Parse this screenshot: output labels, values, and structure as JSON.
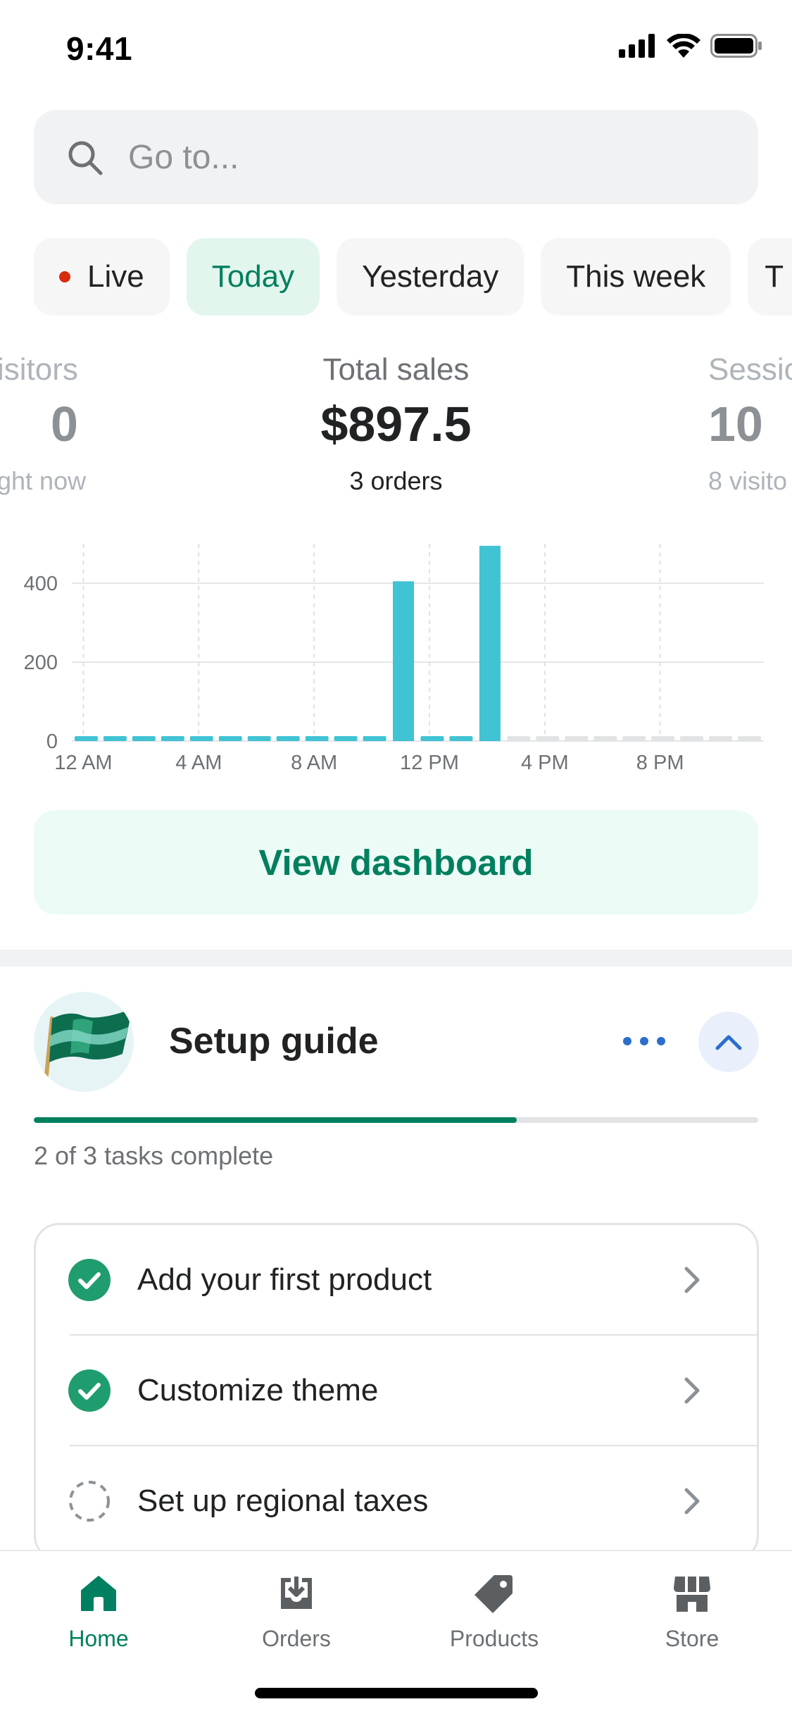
{
  "status_bar": {
    "time": "9:41"
  },
  "search": {
    "placeholder": "Go to..."
  },
  "filters": [
    {
      "label": "Live"
    },
    {
      "label": "Today",
      "active": true
    },
    {
      "label": "Yesterday"
    },
    {
      "label": "This week"
    },
    {
      "label": "T"
    }
  ],
  "metrics": {
    "left": {
      "label": "isitors",
      "value": "0",
      "sub": "ght now"
    },
    "center": {
      "label": "Total sales",
      "value": "$897.5",
      "sub": "3 orders"
    },
    "right": {
      "label": "Sessio",
      "value": "10",
      "sub": "8 visito"
    }
  },
  "chart_data": {
    "type": "bar",
    "x_tick_labels": [
      "12 AM",
      "4 AM",
      "8 AM",
      "12 PM",
      "4 PM",
      "8 PM"
    ],
    "y_tick_labels": [
      "0",
      "200",
      "400"
    ],
    "ylim": [
      0,
      500
    ],
    "hours": [
      "12 AM",
      "1 AM",
      "2 AM",
      "3 AM",
      "4 AM",
      "5 AM",
      "6 AM",
      "7 AM",
      "8 AM",
      "9 AM",
      "10 AM",
      "11 AM",
      "12 PM",
      "1 PM",
      "2 PM",
      "3 PM",
      "4 PM",
      "5 PM",
      "6 PM",
      "7 PM",
      "8 PM",
      "9 PM",
      "10 PM",
      "11 PM"
    ],
    "values": [
      0,
      0,
      0,
      0,
      0,
      0,
      0,
      0,
      0,
      0,
      0,
      405,
      0,
      0,
      495,
      0,
      0,
      0,
      0,
      0,
      0,
      0,
      0,
      0
    ],
    "future_from_hour": 15,
    "colors": {
      "bar": "#40c3d3",
      "future": "#e1e3e5"
    }
  },
  "dashboard_button": {
    "label": "View dashboard"
  },
  "setup_guide": {
    "title": "Setup guide",
    "progress_fraction": 0.667,
    "progress_text": "2 of 3 tasks complete",
    "tasks": [
      {
        "label": "Add your first product",
        "complete": true
      },
      {
        "label": "Customize theme",
        "complete": true
      },
      {
        "label": "Set up regional taxes",
        "complete": false
      }
    ]
  },
  "tab_bar": {
    "tabs": [
      {
        "label": "Home",
        "icon": "home-icon",
        "active": true
      },
      {
        "label": "Orders",
        "icon": "orders-icon"
      },
      {
        "label": "Products",
        "icon": "tag-icon"
      },
      {
        "label": "Store",
        "icon": "store-icon"
      }
    ]
  },
  "colors": {
    "accent": "#008060",
    "link": "#2c6ecb",
    "chart_bar": "#40c3d3"
  }
}
